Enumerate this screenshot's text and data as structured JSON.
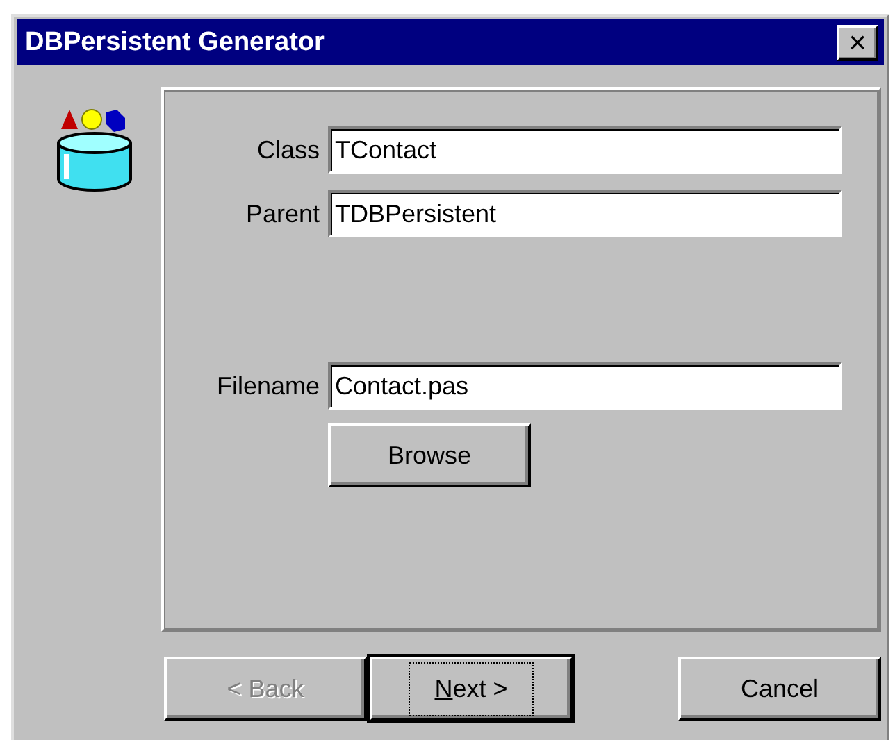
{
  "window": {
    "title": "DBPersistent Generator",
    "close_button": "×"
  },
  "fields": [
    {
      "label": "Class",
      "value": "TContact"
    },
    {
      "label": "Parent",
      "value": "TDBPersistent"
    },
    {
      "label": "Filename",
      "value": "Contact.pas"
    }
  ],
  "browse_button": {
    "label": "Browse"
  },
  "buttons": [
    {
      "label": "< Back",
      "disabled": true,
      "default": false,
      "mnemonic": false
    },
    {
      "label": "Next >",
      "disabled": false,
      "default": true,
      "mnemonic": true
    },
    {
      "label": "Cancel",
      "disabled": false,
      "default": false,
      "mnemonic": false
    }
  ]
}
